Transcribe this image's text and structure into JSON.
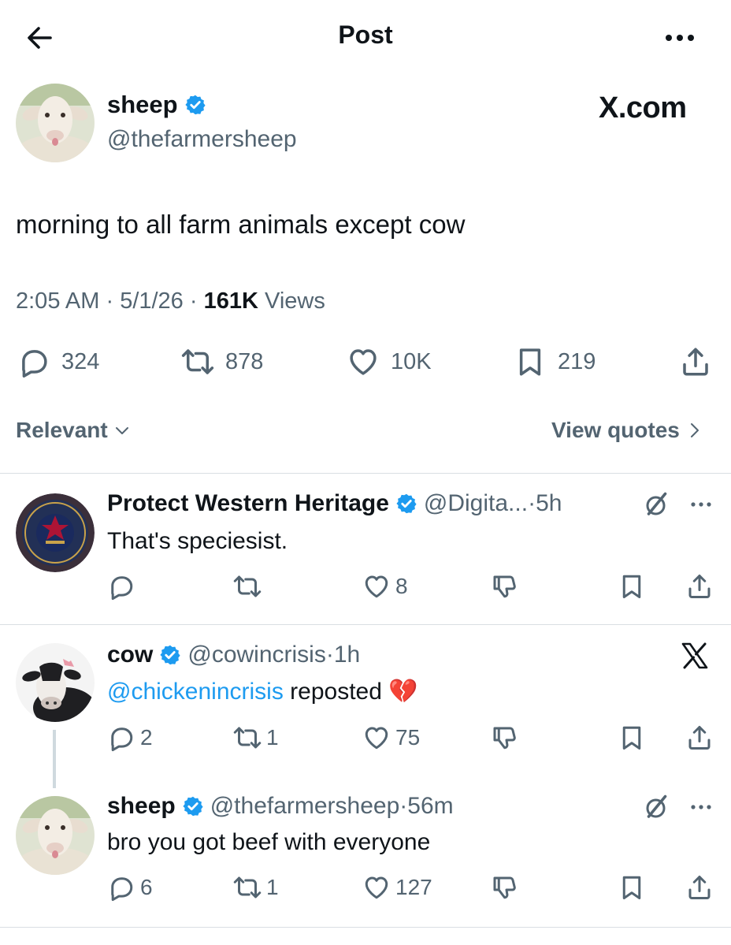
{
  "header": {
    "title": "Post",
    "back_icon": "arrow-left-icon",
    "more_icon": "more-horizontal-icon"
  },
  "post": {
    "name": "sheep",
    "handle": "@thefarmersheep",
    "verified": true,
    "brand": "X.com",
    "text": "morning to all farm animals except cow",
    "time": "2:05 AM",
    "date": "5/1/26",
    "views_count": "161K",
    "views_label": "Views",
    "stats": {
      "replies": "324",
      "reposts": "878",
      "likes": "10K",
      "bookmarks": "219"
    }
  },
  "sort": {
    "relevant": "Relevant",
    "view_quotes": "View quotes"
  },
  "replies": [
    {
      "name": "Protect Western Heritage",
      "handle": "@Digita...",
      "time": "5h",
      "text": "That's speciesist.",
      "stats": {
        "replies": "",
        "reposts": "",
        "likes": "8"
      }
    },
    {
      "name": "cow",
      "handle": "@cowincrisis",
      "time": "1h",
      "mention": "@chickenincrisis",
      "text": " reposted ",
      "emoji": "💔",
      "stats": {
        "replies": "2",
        "reposts": "1",
        "likes": "75"
      }
    },
    {
      "name": "sheep",
      "handle": "@thefarmersheep",
      "time": "56m",
      "text": "bro you got beef with everyone",
      "stats": {
        "replies": "6",
        "reposts": "1",
        "likes": "127"
      }
    }
  ],
  "colors": {
    "accent": "#1d9bf0",
    "text": "#0f1419",
    "secondary": "#536471",
    "divider": "#d9dee3"
  }
}
